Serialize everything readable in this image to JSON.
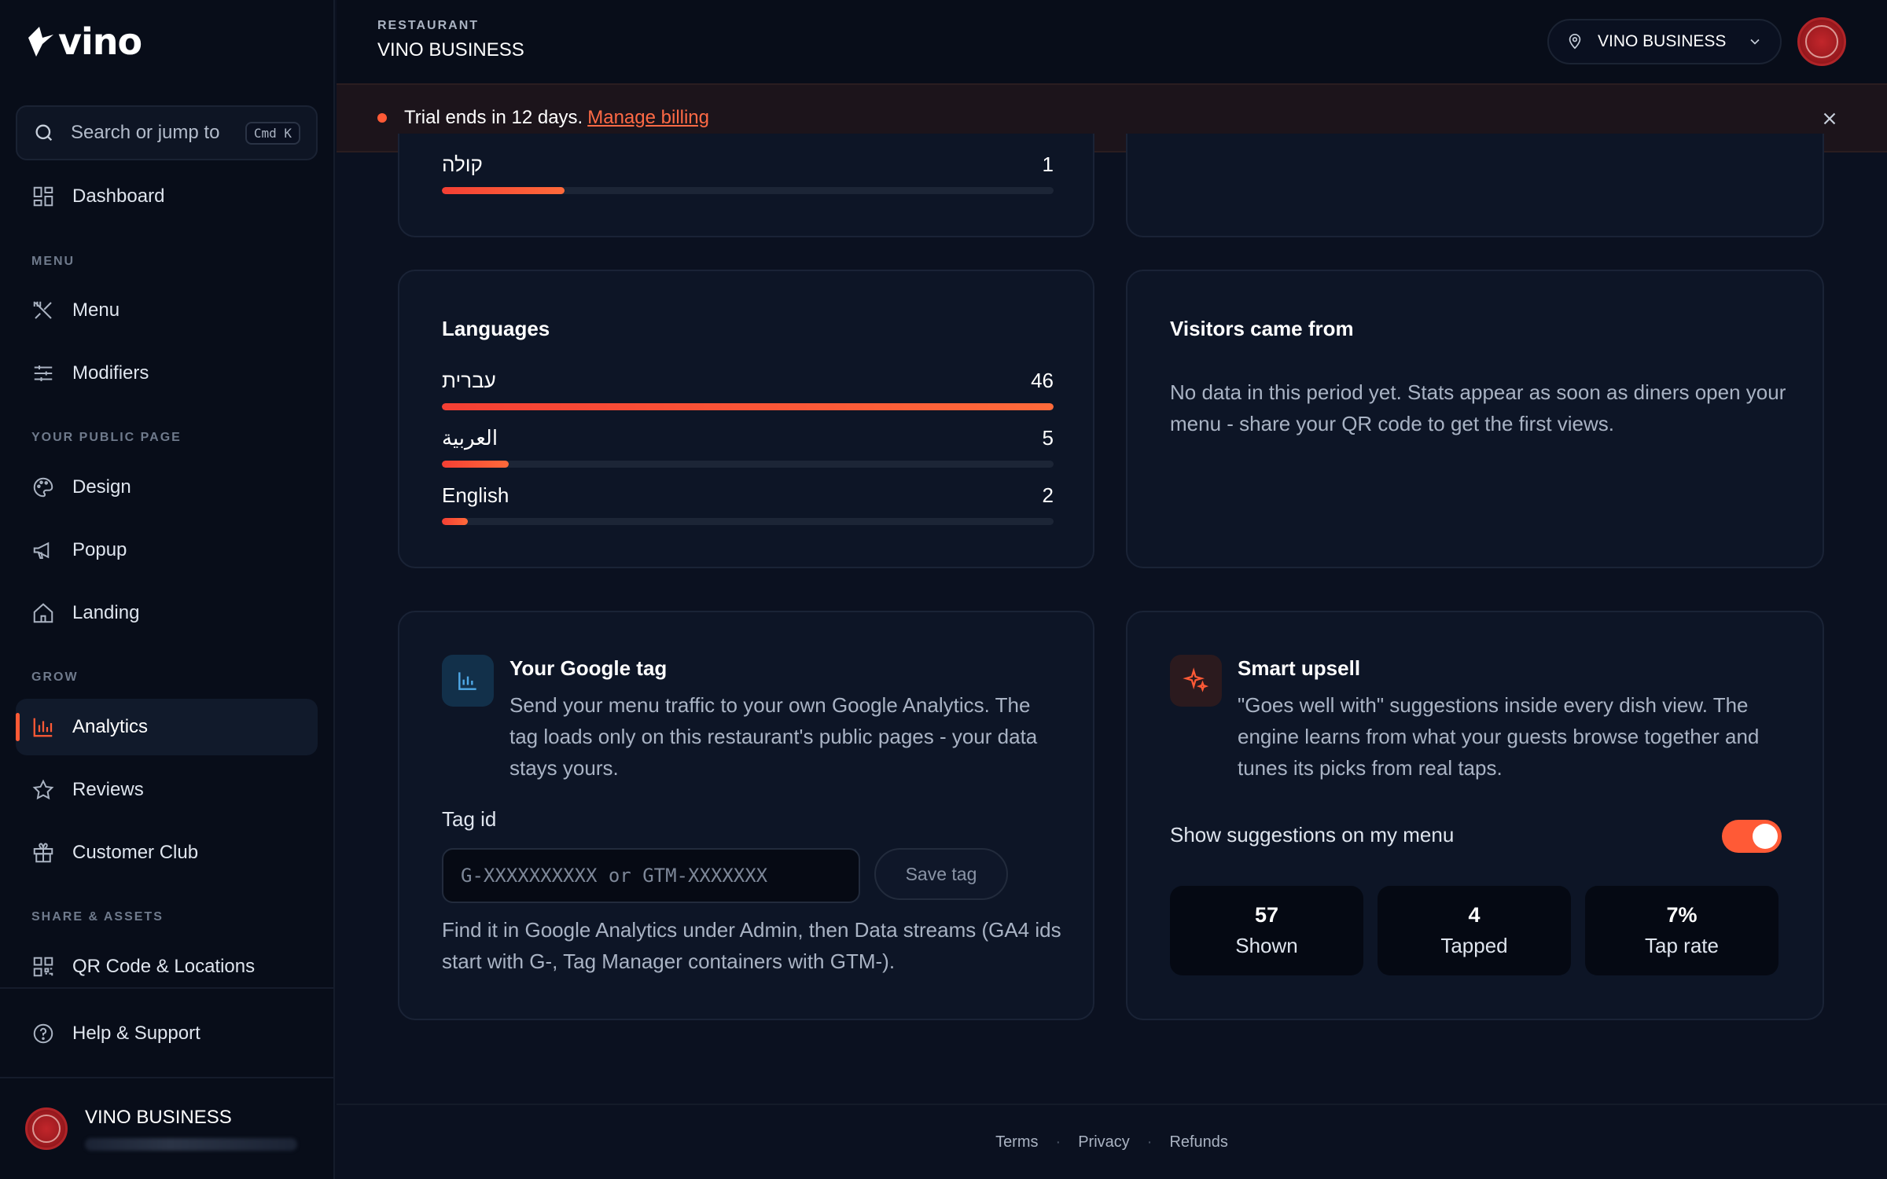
{
  "app": {
    "logo_text": "vino"
  },
  "search": {
    "placeholder": "Search or jump to",
    "shortcut": "Cmd K"
  },
  "sidebar": {
    "dashboard": "Dashboard",
    "sections": {
      "menu": "MENU",
      "public_page": "YOUR PUBLIC PAGE",
      "grow": "GROW",
      "share_assets": "SHARE & ASSETS"
    },
    "items": {
      "menu": "Menu",
      "modifiers": "Modifiers",
      "design": "Design",
      "popup": "Popup",
      "landing": "Landing",
      "analytics": "Analytics",
      "reviews": "Reviews",
      "customer_club": "Customer Club",
      "qr_code": "QR Code & Locations",
      "help": "Help & Support"
    },
    "active": "analytics",
    "accent": "#ff5a36"
  },
  "user": {
    "name": "VINO BUSINESS"
  },
  "header": {
    "label": "RESTAURANT",
    "restaurant_name": "VINO BUSINESS",
    "location_select": "VINO BUSINESS"
  },
  "banner": {
    "text": "Trial ends in 12 days.",
    "link": "Manage billing"
  },
  "top_card": {
    "item_label": "קולה",
    "item_value": "1",
    "item_fraction": 0.2
  },
  "languages": {
    "title": "Languages",
    "rows": [
      {
        "label": "עברית",
        "value": "46",
        "fraction": 1.0
      },
      {
        "label": "العربية",
        "value": "5",
        "fraction": 0.109
      },
      {
        "label": "English",
        "value": "2",
        "fraction": 0.043
      }
    ]
  },
  "visitors": {
    "title": "Visitors came from",
    "text": "No data in this period yet. Stats appear as soon as diners open your menu - share your QR code to get the first views."
  },
  "google_tag": {
    "title": "Your Google tag",
    "desc": "Send your menu traffic to your own Google Analytics. The tag loads only on this restaurant's public pages - your data stays yours.",
    "field_label": "Tag id",
    "placeholder": "G-XXXXXXXXXX or GTM-XXXXXXX",
    "save": "Save tag",
    "help": "Find it in Google Analytics under Admin, then Data streams (GA4 ids start with G-, Tag Manager containers with GTM-)."
  },
  "upsell": {
    "title": "Smart upsell",
    "desc": "\"Goes well with\" suggestions inside every dish view. The engine learns from what your guests browse together and tunes its picks from real taps.",
    "toggle_label": "Show suggestions on my menu",
    "toggle_on": true,
    "stats": [
      {
        "value": "57",
        "label": "Shown"
      },
      {
        "value": "4",
        "label": "Tapped"
      },
      {
        "value": "7%",
        "label": "Tap rate"
      }
    ]
  },
  "footer": {
    "terms": "Terms",
    "privacy": "Privacy",
    "refunds": "Refunds"
  }
}
